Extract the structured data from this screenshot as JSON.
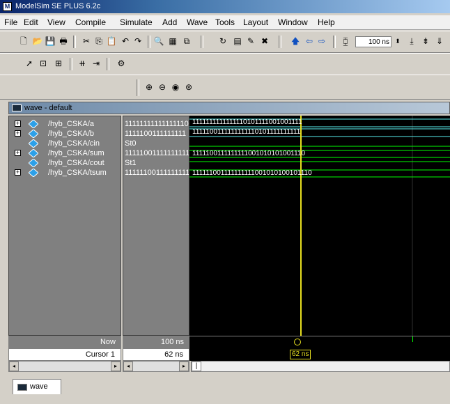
{
  "window": {
    "title": "ModelSim SE PLUS 6.2c",
    "app_icon": "M"
  },
  "menu": [
    "File",
    "Edit",
    "View",
    "Compile",
    "Simulate",
    "Add",
    "Wave",
    "Tools",
    "Layout",
    "Window",
    "Help"
  ],
  "toolbar": {
    "time_step": "100 ns"
  },
  "wave_window": {
    "title": "wave - default",
    "tab_label": "wave"
  },
  "signals": [
    {
      "name": "/hyb_CSKA/a",
      "value": "11111111111111110",
      "wave": "1111111111111110101111001001111",
      "expandable": true,
      "color": "#5af0f0"
    },
    {
      "name": "/hyb_CSKA/b",
      "value": "1111100111111111",
      "wave": "1111100111111111110101111111111",
      "expandable": true,
      "color": "#5af0f0"
    },
    {
      "name": "/hyb_CSKA/cin",
      "value": "St0",
      "wave": "",
      "expandable": false,
      "color": "#00ff00"
    },
    {
      "name": "/hyb_CSKA/sum",
      "value": "11111001111111111",
      "wave": "1111100111111111001010101001110",
      "expandable": true,
      "color": "#00ff00"
    },
    {
      "name": "/hyb_CSKA/cout",
      "value": "St1",
      "wave": "",
      "expandable": false,
      "color": "#00ff00"
    },
    {
      "name": "/hyb_CSKA/tsum",
      "value": "11111100111111111",
      "wave": "111111001111111111001010100101110",
      "expandable": true,
      "color": "#00ff00"
    }
  ],
  "status": {
    "now_label": "Now",
    "now_value": "100 ns",
    "cursor_label": "Cursor 1",
    "cursor_value": "62 ns",
    "cursor_marker": "62 ns"
  }
}
